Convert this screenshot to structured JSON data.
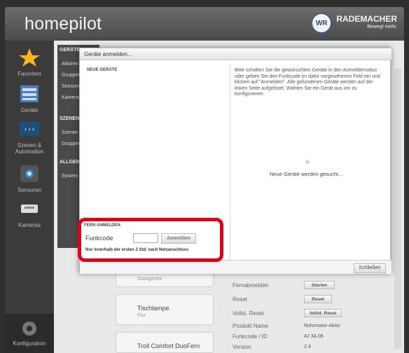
{
  "header": {
    "app_name": "homepilot",
    "brand": "RADEMACHER",
    "brand_sub": "Bewegt mehr.",
    "brand_logo": "WR"
  },
  "sidebar": {
    "items": [
      {
        "label": "Favoriten",
        "icon": "star-icon"
      },
      {
        "label": "Geräte",
        "icon": "devices-icon"
      },
      {
        "label": "Szenen & Automation",
        "icon": "scenes-icon"
      },
      {
        "label": "Sensoren",
        "icon": "sensor-icon"
      },
      {
        "label": "Kameras",
        "icon": "camera-icon"
      }
    ],
    "footer_label": "Konfiguration"
  },
  "subnav": {
    "geraete_head": "GERÄTE",
    "items1": [
      "Aktoren",
      "Gruppen",
      "Sensoren",
      "Kameras"
    ],
    "szenen_head": "SZENEN",
    "items2": [
      "Szenen",
      "Gruppen"
    ],
    "allgemein_head": "ALLGEM",
    "items3": [
      "System"
    ]
  },
  "dialog": {
    "title": "Geräte anmelden...",
    "new_devices_head": "NEUE GERÄTE",
    "info_text": "Bitte schalten Sie die gewünschten Geräte in den Anmeldemodus oder geben Sie den Funkcode im dafür vorgesehenen Feld ein und klicken auf \"Anmelden\". Alle gefundenen Geräte werden auf der linken Seite aufgelistet. Wählen Sie ein Gerät aus um zu konfigurieren.",
    "searching_text": "Neue Geräte werden gesucht...",
    "fern_head": "FERN ANMELDEN",
    "funkcode_label": "Funkcode",
    "funkcode_value": "",
    "anmelden_label": "Anmelden",
    "note": "Nur innerhalb der ersten 2 Std. nach Netzanschluss",
    "close_label": "Schließen"
  },
  "devices": [
    {
      "name": "",
      "sub": "Garagentor"
    },
    {
      "name": "Tischlampe",
      "sub": "Flur"
    },
    {
      "name": "Troll Comfort DuoFern",
      "sub": ""
    }
  ],
  "properties": {
    "fernabmelden": "Fernabmelden",
    "start_label": "Starten",
    "reset": "Reset",
    "reset_btn": "Reset",
    "volist_reset": "Vollst. Reset",
    "volist_btn": "Vollst. Reset",
    "produkt_name_label": "Produkt Name",
    "produkt_name": "Rohrmotor-Aktor",
    "funkcode_id_label": "Funkcode / ID",
    "funkcode_id": "42 3A 08",
    "version_label": "Version",
    "version": "2.4"
  },
  "colors": {
    "highlight": "#e3001b",
    "accent_star": "#f5b81c"
  }
}
